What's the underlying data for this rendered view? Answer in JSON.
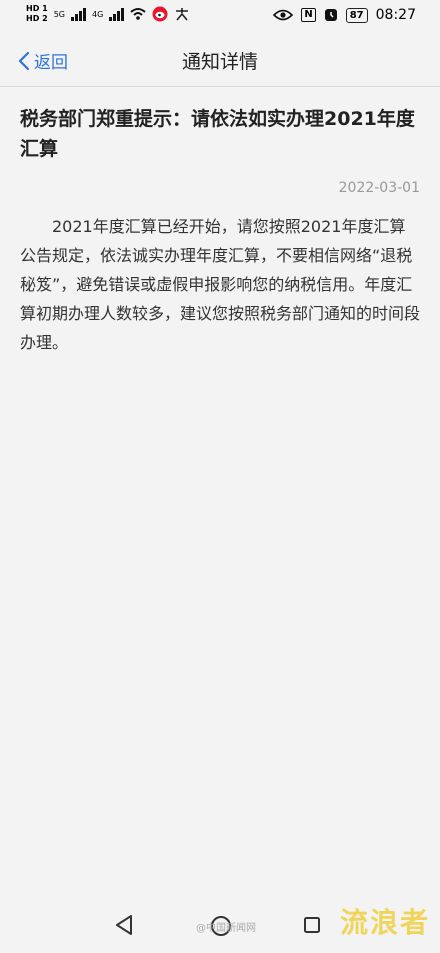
{
  "status_bar": {
    "hd1": "HD 1",
    "hd2": "HD 2",
    "net1": "5G",
    "net2": "4G",
    "nfc": "N",
    "battery": "87",
    "time": "08:27"
  },
  "header": {
    "back_label": "返回",
    "title": "通知详情"
  },
  "article": {
    "title": "税务部门郑重提示：请依法如实办理2021年度汇算",
    "date": "2022-03-01",
    "body": "2021年度汇算已经开始，请您按照2021年度汇算公告规定，依法诚实办理年度汇算，不要相信网络“退税秘笈”，避免错误或虚假申报影响您的纳税信用。年度汇算初期办理人数较多，建议您按照税务部门通知的时间段办理。"
  },
  "watermark": {
    "source": "@中国新闻网",
    "brand": "流浪者"
  },
  "colors": {
    "accent": "#2f73d9",
    "background": "#f3f3f3"
  }
}
